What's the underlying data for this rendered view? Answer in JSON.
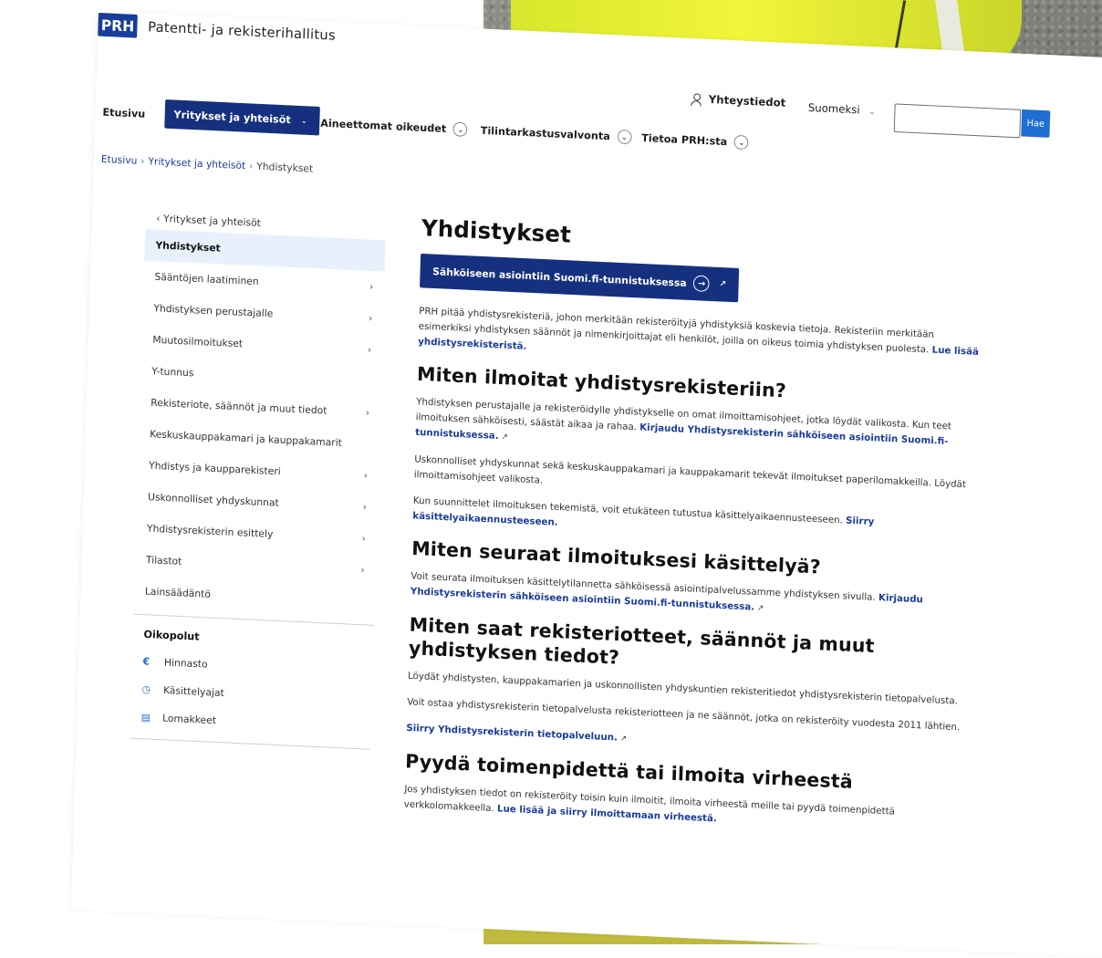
{
  "header": {
    "logo": "PRH",
    "org_name": "Patentti- ja rekisterihallitus",
    "contact": "Yhteystiedot",
    "language": "Suomeksi",
    "search_button": "Hae"
  },
  "nav": {
    "items": [
      {
        "label": "Etusivu"
      },
      {
        "label": "Yritykset ja yhteisöt"
      },
      {
        "label": "Aineettomat oikeudet"
      },
      {
        "label": "Tilintarkastusvalvonta"
      },
      {
        "label": "Tietoa PRH:sta"
      }
    ]
  },
  "breadcrumb": [
    "Etusivu",
    "Yritykset ja yhteisöt",
    "Yhdistykset"
  ],
  "sidebar": {
    "back": "‹ Yritykset ja yhteisöt",
    "items": [
      {
        "label": "Yhdistykset"
      },
      {
        "label": "Sääntöjen laatiminen"
      },
      {
        "label": "Yhdistyksen perustajalle"
      },
      {
        "label": "Muutosilmoitukset"
      },
      {
        "label": "Y-tunnus"
      },
      {
        "label": "Rekisteriote, säännöt ja muut tiedot"
      },
      {
        "label": "Keskuskauppakamari ja kauppakamarit"
      },
      {
        "label": "Yhdistys ja kaupparekisteri"
      },
      {
        "label": "Uskonnolliset yhdyskunnat"
      },
      {
        "label": "Yhdistysrekisterin esittely"
      },
      {
        "label": "Tilastot"
      },
      {
        "label": "Lainsäädäntö"
      }
    ],
    "shortcuts_heading": "Oikopolut",
    "shortcuts": [
      {
        "label": "Hinnasto"
      },
      {
        "label": "Käsittelyajat"
      },
      {
        "label": "Lomakkeet"
      }
    ]
  },
  "main": {
    "title": "Yhdistykset",
    "cta": "Sähköiseen asiointiin Suomi.fi-tunnistuksessa",
    "intro": "PRH pitää yhdistysrekisteriä, johon merkitään rekisteröityjä yhdistyksiä koskevia tietoja. Rekisteriin merkitään esimerkiksi yhdistyksen säännöt ja nimenkirjoittajat eli henkilöt, joilla on oikeus toimia yhdistyksen puolesta.",
    "intro_link": "Lue lisää yhdistysrekisteristä.",
    "s1_title": "Miten ilmoitat yhdistysrekisteriin?",
    "s1_p1": "Yhdistyksen perustajalle ja rekisteröidylle yhdistykselle on omat ilmoittamisohjeet, jotka löydät valikosta. Kun teet ilmoituksen sähköisesti, säästät aikaa ja rahaa.",
    "s1_p1_link": "Kirjaudu Yhdistysrekisterin sähköiseen asiointiin Suomi.fi-tunnistuksessa.",
    "s1_p2": "Uskonnolliset yhdyskunnat sekä keskuskauppakamari ja kauppakamarit tekevät ilmoitukset paperilomakkeilla. Löydät ilmoittamisohjeet valikosta.",
    "s1_p3": "Kun suunnittelet ilmoituksen tekemistä, voit etukäteen tutustua käsittelyaikaennusteeseen.",
    "s1_p3_link": "Siirry käsittelyaikaennusteeseen.",
    "s2_title": "Miten seuraat ilmoituksesi käsittelyä?",
    "s2_p1": "Voit seurata ilmoituksen käsittelytilannetta sähköisessä asiointipalvelussamme yhdistyksen sivulla.",
    "s2_p1_link": "Kirjaudu Yhdistysrekisterin sähköiseen asiointiin Suomi.fi-tunnistuksessa.",
    "s3_title": "Miten saat rekisteriotteet, säännöt ja muut yhdistyksen tiedot?",
    "s3_p1": "Löydät yhdistysten, kauppakamarien ja uskonnollisten yhdyskuntien rekisteritiedot yhdistysrekisterin tietopalvelusta.",
    "s3_p2": "Voit ostaa yhdistysrekisterin tietopalvelusta rekisteriotteen ja ne säännöt, jotka on rekisteröity vuodesta 2011 lähtien.",
    "s3_link": "Siirry Yhdistysrekisterin tietopalveluun.",
    "s4_title": "Pyydä toimenpidettä tai ilmoita virheestä",
    "s4_p1": "Jos yhdistyksen tiedot on rekisteröity toisin kuin ilmoitit, ilmoita virheestä meille tai pyydä toimenpidettä verkkolomakkeella.",
    "s4_link": "Lue lisää ja siirry ilmoittamaan virheestä."
  }
}
